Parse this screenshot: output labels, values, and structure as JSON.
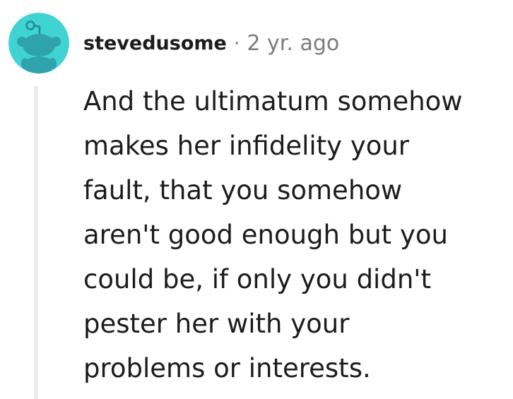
{
  "comment": {
    "author": "stevedusome",
    "separator": "·",
    "timestamp": "2 yr. ago",
    "avatar_icon": "reddit-snoo-avatar-icon",
    "avatar_color": "#3fd3d3",
    "thread_line_color": "#ededed",
    "body": "And the ultimatum somehow\nmakes her infidelity your\nfault, that you somehow\naren't good enough but you\ncould be, if only you didn't\npester her with your\nproblems or interests."
  }
}
